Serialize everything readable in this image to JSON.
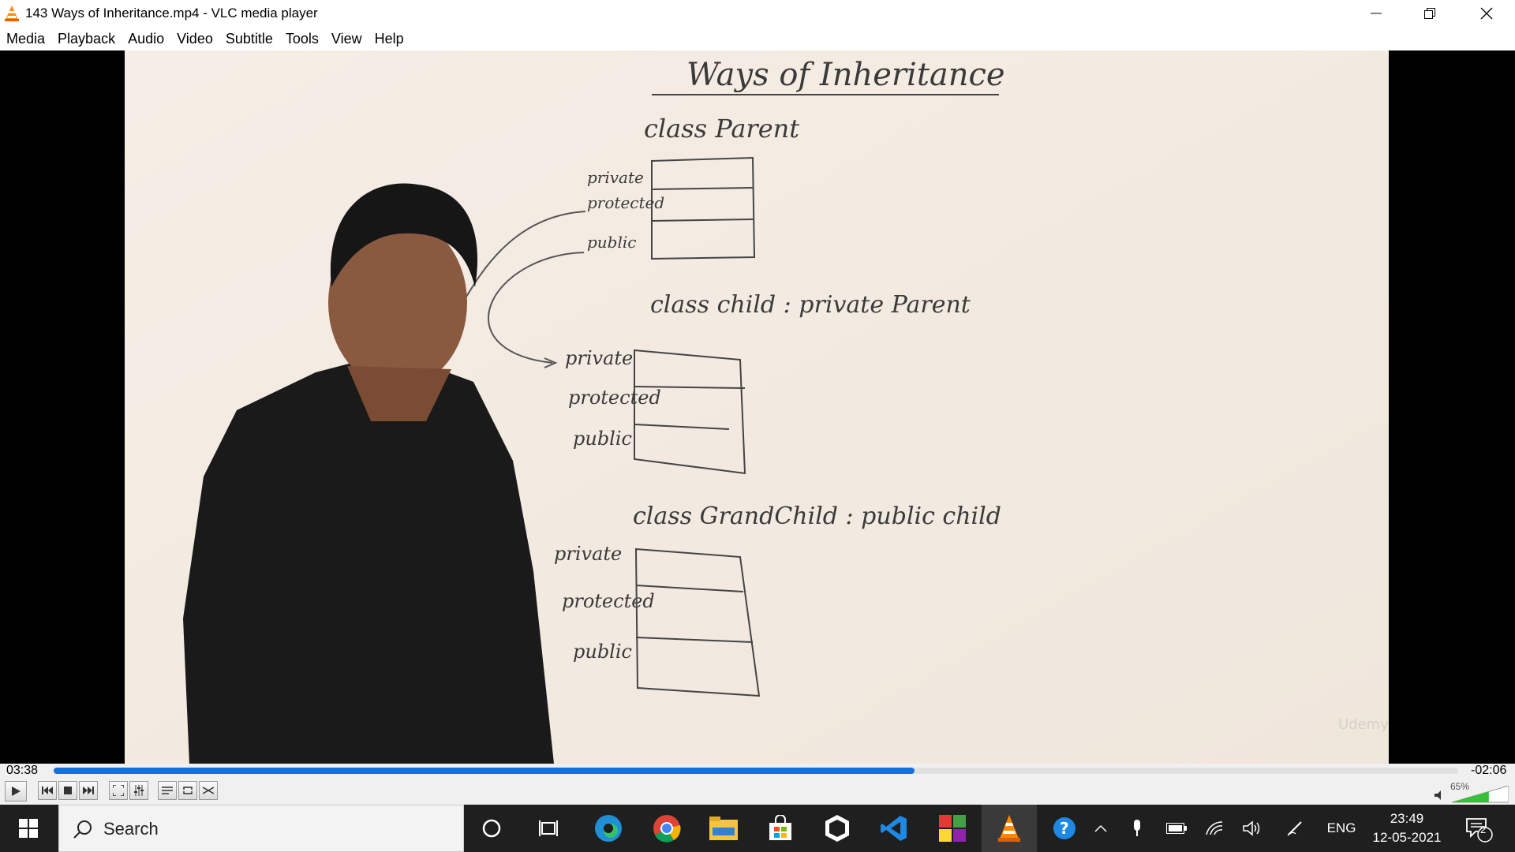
{
  "window": {
    "title": "143 Ways of Inheritance.mp4 - VLC media player",
    "icon": "vlc-cone-icon"
  },
  "menu": [
    "Media",
    "Playback",
    "Audio",
    "Video",
    "Subtitle",
    "Tools",
    "View",
    "Help"
  ],
  "whiteboard": {
    "heading": "Ways of Inheritance",
    "class1": "class Parent",
    "class2": "class child : private Parent",
    "class3": "class GrandChild : public child",
    "labels1": [
      "private",
      "protected",
      "public"
    ],
    "labels2": [
      "private",
      "protected",
      "public"
    ],
    "labels3": [
      "private",
      "protected",
      "public"
    ],
    "watermark": "Udemy"
  },
  "playback": {
    "elapsed": "03:38",
    "remaining": "-02:06",
    "progress": 0.613,
    "volume": "65%",
    "volume_level": 0.65
  },
  "taskbar": {
    "search_placeholder": "Search",
    "language": "ENG",
    "time": "23:49",
    "date": "12-05-2021",
    "notification_count": "2"
  },
  "colors": {
    "accent": "#1a6fd6",
    "taskbar": "#1f1f1f",
    "whiteboard": "#f4ece4"
  }
}
